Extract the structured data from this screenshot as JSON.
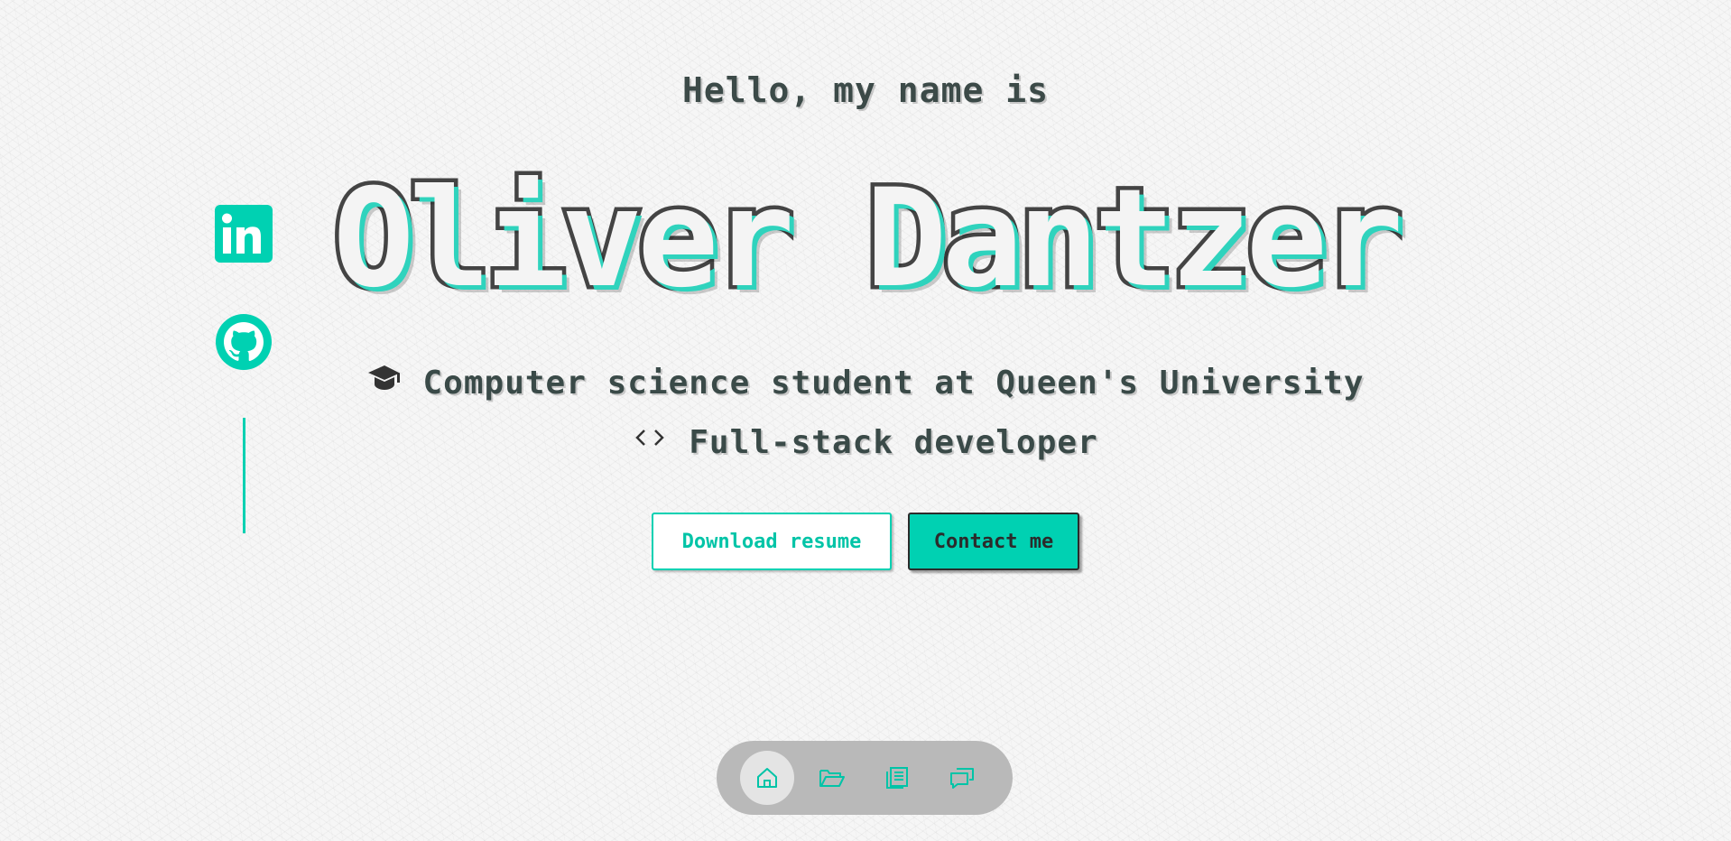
{
  "hero": {
    "greeting": "Hello, my name is",
    "name": "Oliver Dantzer",
    "taglines": [
      {
        "icon": "graduation-cap-icon",
        "text": "Computer science student at Queen's University"
      },
      {
        "icon": "code-brackets-icon",
        "text": "Full-stack developer"
      }
    ]
  },
  "actions": {
    "download_resume": "Download resume",
    "contact": "Contact me"
  },
  "social": [
    {
      "icon": "linkedin-icon"
    },
    {
      "icon": "github-icon"
    }
  ],
  "dock": {
    "items": [
      {
        "icon": "home-icon",
        "active": true
      },
      {
        "icon": "folder-open-icon",
        "active": false
      },
      {
        "icon": "articles-icon",
        "active": false
      },
      {
        "icon": "chat-bubbles-icon",
        "active": false
      }
    ]
  },
  "colors": {
    "accent": "#00d1b2",
    "text": "#3f3f3f",
    "background": "#f6f6f6",
    "dock": "#b9b9b9"
  }
}
